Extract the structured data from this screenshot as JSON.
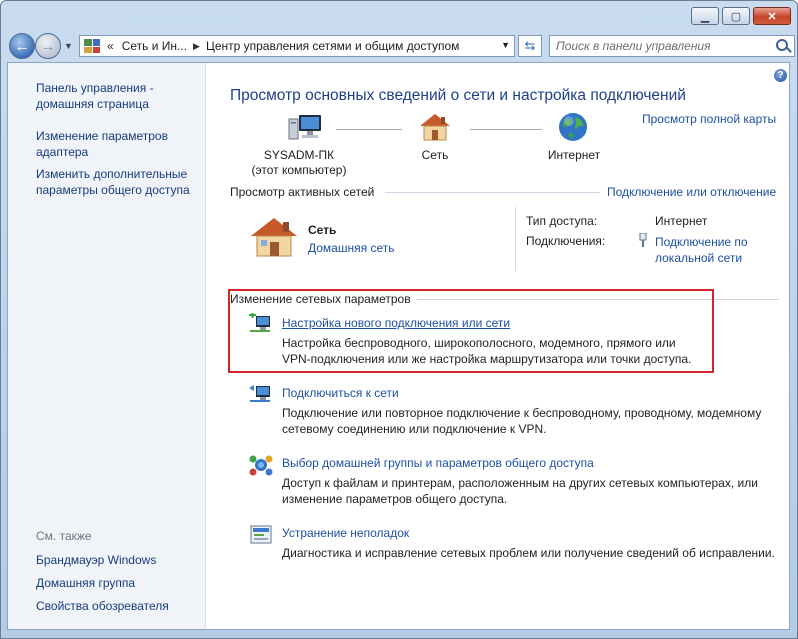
{
  "window": {
    "buttons": {
      "minimize": "▁",
      "maximize": "▢",
      "close": "✕"
    }
  },
  "navbar": {
    "address_segments": [
      "Сеть и Ин...",
      "Центр управления сетями и общим доступом"
    ],
    "address_prefix": "«",
    "search_placeholder": "Поиск в панели управления"
  },
  "sidebar": {
    "links": [
      "Панель управления - домашняя страница",
      "Изменение параметров адаптера",
      "Изменить дополнительные параметры общего доступа"
    ],
    "see_also_label": "См. также",
    "see_also_links": [
      "Брандмауэр Windows",
      "Домашняя группа",
      "Свойства обозревателя"
    ]
  },
  "main": {
    "title": "Просмотр основных сведений о сети и настройка подключений",
    "full_map_link": "Просмотр полной карты",
    "map": {
      "computer_label_1": "SYSADM-ПК",
      "computer_label_2": "(этот компьютер)",
      "network_label": "Сеть",
      "internet_label": "Интернет"
    },
    "active_networks": {
      "header": "Просмотр активных сетей",
      "connect_link": "Подключение или отключение",
      "network_name": "Сеть",
      "network_type": "Домашняя сеть",
      "access_type_label": "Тип доступа:",
      "access_type_value": "Интернет",
      "connections_label": "Подключения:",
      "connections_value_1": "Подключение по",
      "connections_value_2": "локальной сети"
    },
    "change_settings": {
      "header": "Изменение сетевых параметров",
      "tasks": [
        {
          "link": "Настройка нового подключения или сети",
          "desc_1": "Настройка беспроводного, широкополосного, модемного, прямого или",
          "desc_2": "VPN-подключения или же настройка маршрутизатора или точки доступа."
        },
        {
          "link": "Подключиться к сети",
          "desc_1": "Подключение или повторное подключение к беспроводному, проводному, модемному",
          "desc_2": "сетевому соединению или подключение к VPN."
        },
        {
          "link": "Выбор домашней группы и параметров общего доступа",
          "desc_1": "Доступ к файлам и принтерам, расположенным на других сетевых компьютерах, или",
          "desc_2": "изменение параметров общего доступа."
        },
        {
          "link": "Устранение неполадок",
          "desc_1": "Диагностика и исправление сетевых проблем или получение сведений об исправлении.",
          "desc_2": ""
        }
      ]
    }
  }
}
